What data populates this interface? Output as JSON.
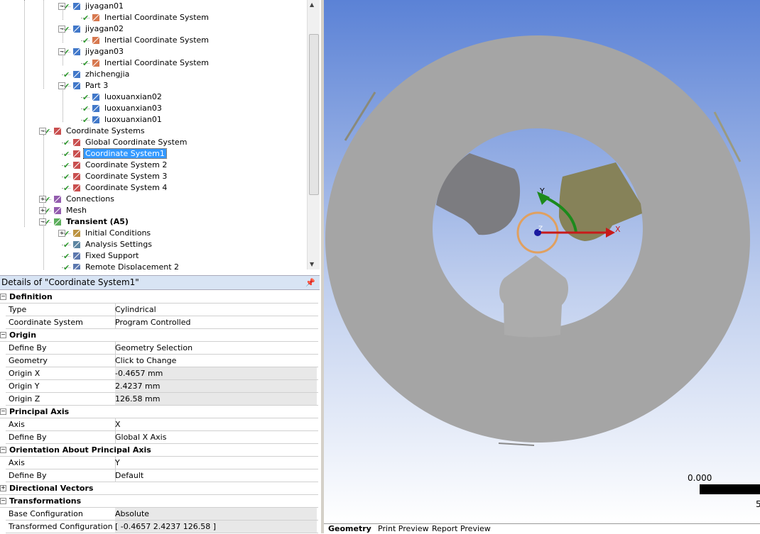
{
  "tree": {
    "items": [
      {
        "label": "jiyagan01",
        "indent": 3
      },
      {
        "label": "Inertial Coordinate System",
        "indent": 4
      },
      {
        "label": "jiyagan02",
        "indent": 3
      },
      {
        "label": "Inertial Coordinate System",
        "indent": 4
      },
      {
        "label": "jiyagan03",
        "indent": 3
      },
      {
        "label": "Inertial Coordinate System",
        "indent": 4
      },
      {
        "label": "zhichengjia",
        "indent": 3
      },
      {
        "label": "Part 3",
        "indent": 3
      },
      {
        "label": "luoxuanxian02",
        "indent": 4
      },
      {
        "label": "luoxuanxian03",
        "indent": 4
      },
      {
        "label": "luoxuanxian01",
        "indent": 4
      },
      {
        "label": "Coordinate Systems",
        "indent": 2
      },
      {
        "label": "Global Coordinate System",
        "indent": 3
      },
      {
        "label": "Coordinate System1",
        "indent": 3
      },
      {
        "label": "Coordinate System 2",
        "indent": 3
      },
      {
        "label": "Coordinate System 3",
        "indent": 3
      },
      {
        "label": "Coordinate System 4",
        "indent": 3
      },
      {
        "label": "Connections",
        "indent": 2
      },
      {
        "label": "Mesh",
        "indent": 2
      },
      {
        "label": "Transient (A5)",
        "indent": 2
      },
      {
        "label": "Initial Conditions",
        "indent": 3
      },
      {
        "label": "Analysis Settings",
        "indent": 3
      },
      {
        "label": "Fixed Support",
        "indent": 3
      },
      {
        "label": "Remote Displacement 2",
        "indent": 3
      }
    ]
  },
  "details": {
    "title": "Details of \"Coordinate System1\"",
    "pin": "࿠",
    "groups": [
      {
        "label": "Definition",
        "rows": [
          {
            "k": "Type",
            "v": "Cylindrical"
          },
          {
            "k": "Coordinate System",
            "v": "Program Controlled"
          }
        ]
      },
      {
        "label": "Origin",
        "rows": [
          {
            "k": "Define By",
            "v": "Geometry Selection"
          },
          {
            "k": "Geometry",
            "v": "Click to Change"
          },
          {
            "k": "Origin X",
            "v": "-0.4657 mm"
          },
          {
            "k": "Origin Y",
            "v": "2.4237 mm"
          },
          {
            "k": "Origin Z",
            "v": "126.58 mm"
          }
        ]
      },
      {
        "label": "Principal Axis",
        "rows": [
          {
            "k": "Axis",
            "v": "X"
          },
          {
            "k": "Define By",
            "v": "Global X Axis"
          }
        ]
      },
      {
        "label": "Orientation About Principal Axis",
        "rows": [
          {
            "k": "Axis",
            "v": "Y"
          },
          {
            "k": "Define By",
            "v": "Default"
          }
        ]
      },
      {
        "label": "Directional Vectors",
        "rows": []
      },
      {
        "label": "Transformations",
        "rows": [
          {
            "k": "Base Configuration",
            "v": "Absolute"
          },
          {
            "k": "Transformed Configuration",
            "v": "[ -0.4657  2.4237  126.58 ]"
          }
        ]
      }
    ]
  },
  "viewport": {
    "axis_x": "X",
    "axis_y": "Y",
    "axis_z": "Z",
    "scale_start": "0.000",
    "scale_end": "5"
  },
  "tabs": [
    "Geometry",
    "Print Preview",
    "Report Preview"
  ]
}
